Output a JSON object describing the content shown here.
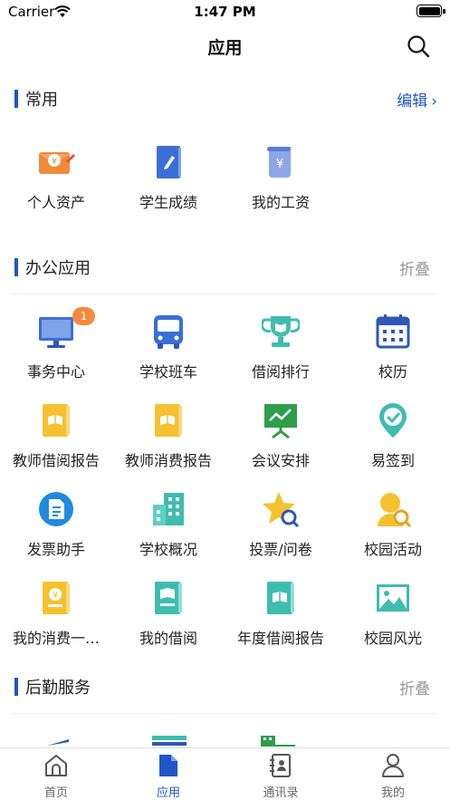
{
  "status": {
    "carrier": "Carrier",
    "time": "1:47 PM"
  },
  "nav": {
    "title": "应用"
  },
  "sections": {
    "common": {
      "title": "常用",
      "action": "编辑"
    },
    "office": {
      "title": "办公应用",
      "action": "折叠"
    },
    "logistics": {
      "title": "后勤服务",
      "action": "折叠"
    }
  },
  "common_items": [
    {
      "label": "个人资产",
      "icon": "personal-assets-icon"
    },
    {
      "label": "学生成绩",
      "icon": "student-grades-icon"
    },
    {
      "label": "我的工资",
      "icon": "salary-icon"
    }
  ],
  "office_items": [
    {
      "label": "事务中心",
      "icon": "monitor-icon",
      "badge": "1"
    },
    {
      "label": "学校班车",
      "icon": "bus-icon"
    },
    {
      "label": "借阅排行",
      "icon": "trophy-icon"
    },
    {
      "label": "校历",
      "icon": "calendar-icon"
    },
    {
      "label": "教师借阅报告",
      "icon": "book-report-icon"
    },
    {
      "label": "教师消费报告",
      "icon": "consumption-report-icon"
    },
    {
      "label": "会议安排",
      "icon": "presentation-icon"
    },
    {
      "label": "易签到",
      "icon": "location-check-icon"
    },
    {
      "label": "发票助手",
      "icon": "invoice-icon"
    },
    {
      "label": "学校概况",
      "icon": "building-icon"
    },
    {
      "label": "投票/问卷",
      "icon": "star-vote-icon"
    },
    {
      "label": "校园活动",
      "icon": "activity-icon"
    },
    {
      "label": "我的消费一…",
      "icon": "consumption-icon"
    },
    {
      "label": "我的借阅",
      "icon": "my-borrow-icon"
    },
    {
      "label": "年度借阅报告",
      "icon": "annual-report-icon"
    },
    {
      "label": "校园风光",
      "icon": "scenery-icon"
    }
  ],
  "tabs": [
    {
      "label": "首页",
      "icon": "home-icon"
    },
    {
      "label": "应用",
      "icon": "apps-icon",
      "active": true
    },
    {
      "label": "通讯录",
      "icon": "contacts-icon"
    },
    {
      "label": "我的",
      "icon": "profile-icon"
    }
  ],
  "colors": {
    "accent": "#1e56c6",
    "badge": "#f58a3c",
    "teal": "#3fbcb0",
    "yellow": "#f5c12e",
    "blue": "#3a6fd8",
    "indigo": "#2f57b8",
    "orange": "#f08a3a"
  }
}
